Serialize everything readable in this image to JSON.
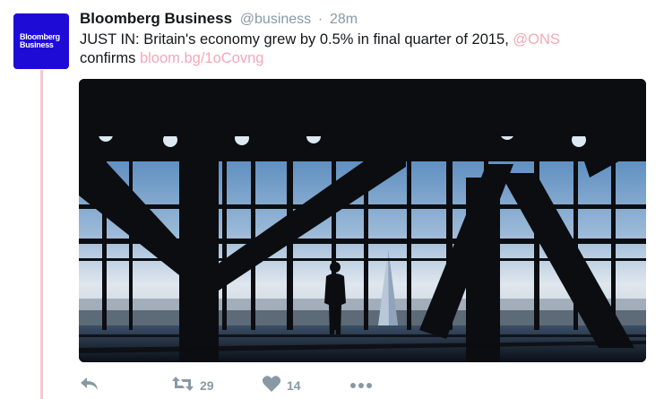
{
  "tweet": {
    "avatar_label_line1": "Bloomberg",
    "avatar_label_line2": "Business",
    "display_name": "Bloomberg Business",
    "handle": "@business",
    "separator": "·",
    "time": "28m",
    "text_main": "JUST IN: Britain's economy grew by 0.5% in final quarter of 2015, ",
    "mention": "@ONS",
    "text_after": "confirms ",
    "link": "bloom.bg/1oCovng",
    "colors": {
      "avatar_bg": "#1f0bd6",
      "link": "#f4a8b9",
      "thread_line": "#f5c9d3",
      "action_gray": "#8899a6"
    }
  },
  "actions": {
    "reply_icon": "reply-icon",
    "retweet_icon": "retweet-icon",
    "retweet_count": "29",
    "like_icon": "heart-icon",
    "like_count": "14",
    "more_icon": "more-icon"
  }
}
